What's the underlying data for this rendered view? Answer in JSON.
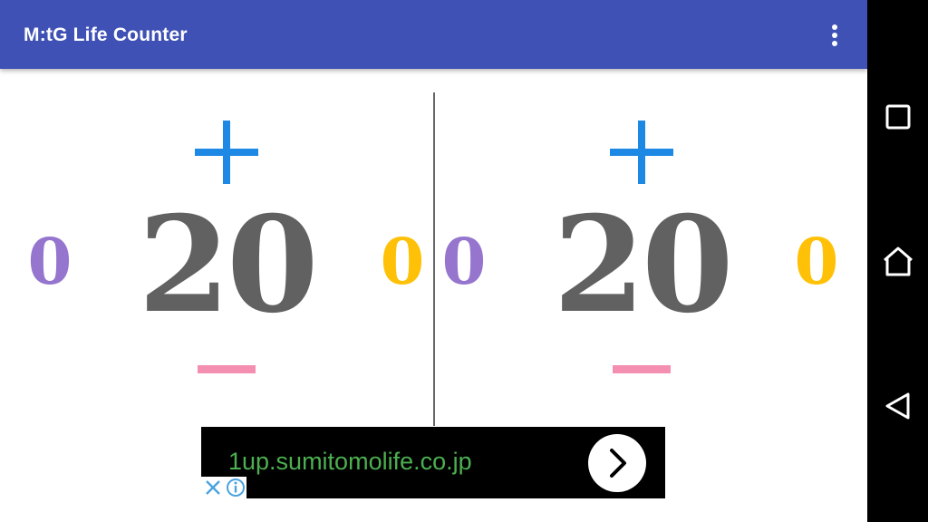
{
  "app": {
    "title": "M:tG Life Counter",
    "header_color": "#3f51b5"
  },
  "players": [
    {
      "life": "20",
      "counter_left": "0",
      "counter_right": "0"
    },
    {
      "life": "20",
      "counter_left": "0",
      "counter_right": "0"
    }
  ],
  "colors": {
    "plus": "#1e88e5",
    "minus": "#f48fb1",
    "life_text": "#616161",
    "counter_left": "#9575cd",
    "counter_right": "#ffc107"
  },
  "ad": {
    "url_text": "1up.sumitomolife.co.jp",
    "url_color": "#4caf50"
  },
  "icons": {
    "menu": "more-vert-icon",
    "ad_go": "chevron-right-icon",
    "ad_close": "close-icon",
    "ad_info": "info-icon",
    "nav_recents": "square-icon",
    "nav_home": "home-icon",
    "nav_back": "back-triangle-icon"
  }
}
